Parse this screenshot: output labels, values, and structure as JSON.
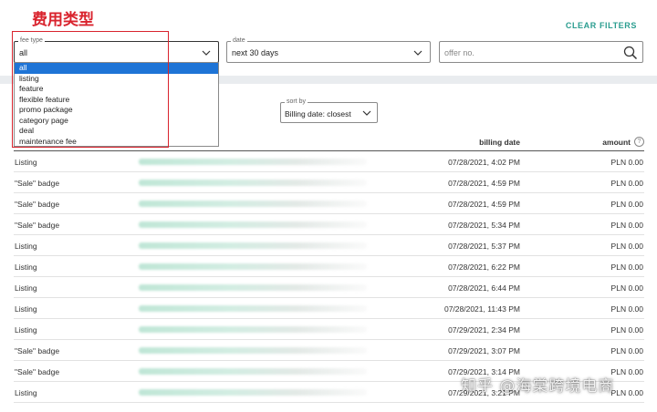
{
  "annotation": {
    "title": "费用类型"
  },
  "header": {
    "clear_filters": "CLEAR FILTERS"
  },
  "filters": {
    "fee_type": {
      "label": "fee type",
      "value": "all"
    },
    "date": {
      "label": "date",
      "value": "next 30 days"
    },
    "offer": {
      "placeholder": "offer no."
    }
  },
  "fee_type_options": [
    "all",
    "listing",
    "feature",
    "flexible feature",
    "promo package",
    "category page",
    "deal",
    "maintenance fee"
  ],
  "sort": {
    "label": "sort by",
    "value": "Billing date: closest"
  },
  "table": {
    "columns": {
      "billing_date": "billing date",
      "amount": "amount"
    },
    "help_icon": "?",
    "rows": [
      {
        "name": "Listing",
        "date": "07/28/2021, 4:02 PM",
        "amount": "PLN 0.00"
      },
      {
        "name": "\"Sale\" badge",
        "date": "07/28/2021, 4:59 PM",
        "amount": "PLN 0.00"
      },
      {
        "name": "\"Sale\" badge",
        "date": "07/28/2021, 4:59 PM",
        "amount": "PLN 0.00"
      },
      {
        "name": "\"Sale\" badge",
        "date": "07/28/2021, 5:34 PM",
        "amount": "PLN 0.00"
      },
      {
        "name": "Listing",
        "date": "07/28/2021, 5:37 PM",
        "amount": "PLN 0.00"
      },
      {
        "name": "Listing",
        "date": "07/28/2021, 6:22 PM",
        "amount": "PLN 0.00"
      },
      {
        "name": "Listing",
        "date": "07/28/2021, 6:44 PM",
        "amount": "PLN 0.00"
      },
      {
        "name": "Listing",
        "date": "07/28/2021, 11:43 PM",
        "amount": "PLN 0.00"
      },
      {
        "name": "Listing",
        "date": "07/29/2021, 2:34 PM",
        "amount": "PLN 0.00"
      },
      {
        "name": "\"Sale\" badge",
        "date": "07/29/2021, 3:07 PM",
        "amount": "PLN 0.00"
      },
      {
        "name": "\"Sale\" badge",
        "date": "07/29/2021, 3:14 PM",
        "amount": "PLN 0.00"
      },
      {
        "name": "Listing",
        "date": "07/29/2021, 3:21 PM",
        "amount": "PLN 0.00"
      }
    ]
  },
  "watermark": "知乎 @海棠跨境电商",
  "colors": {
    "accent": "#2a9d8f",
    "selected": "#1e74d6",
    "annotation": "#d9232d"
  }
}
